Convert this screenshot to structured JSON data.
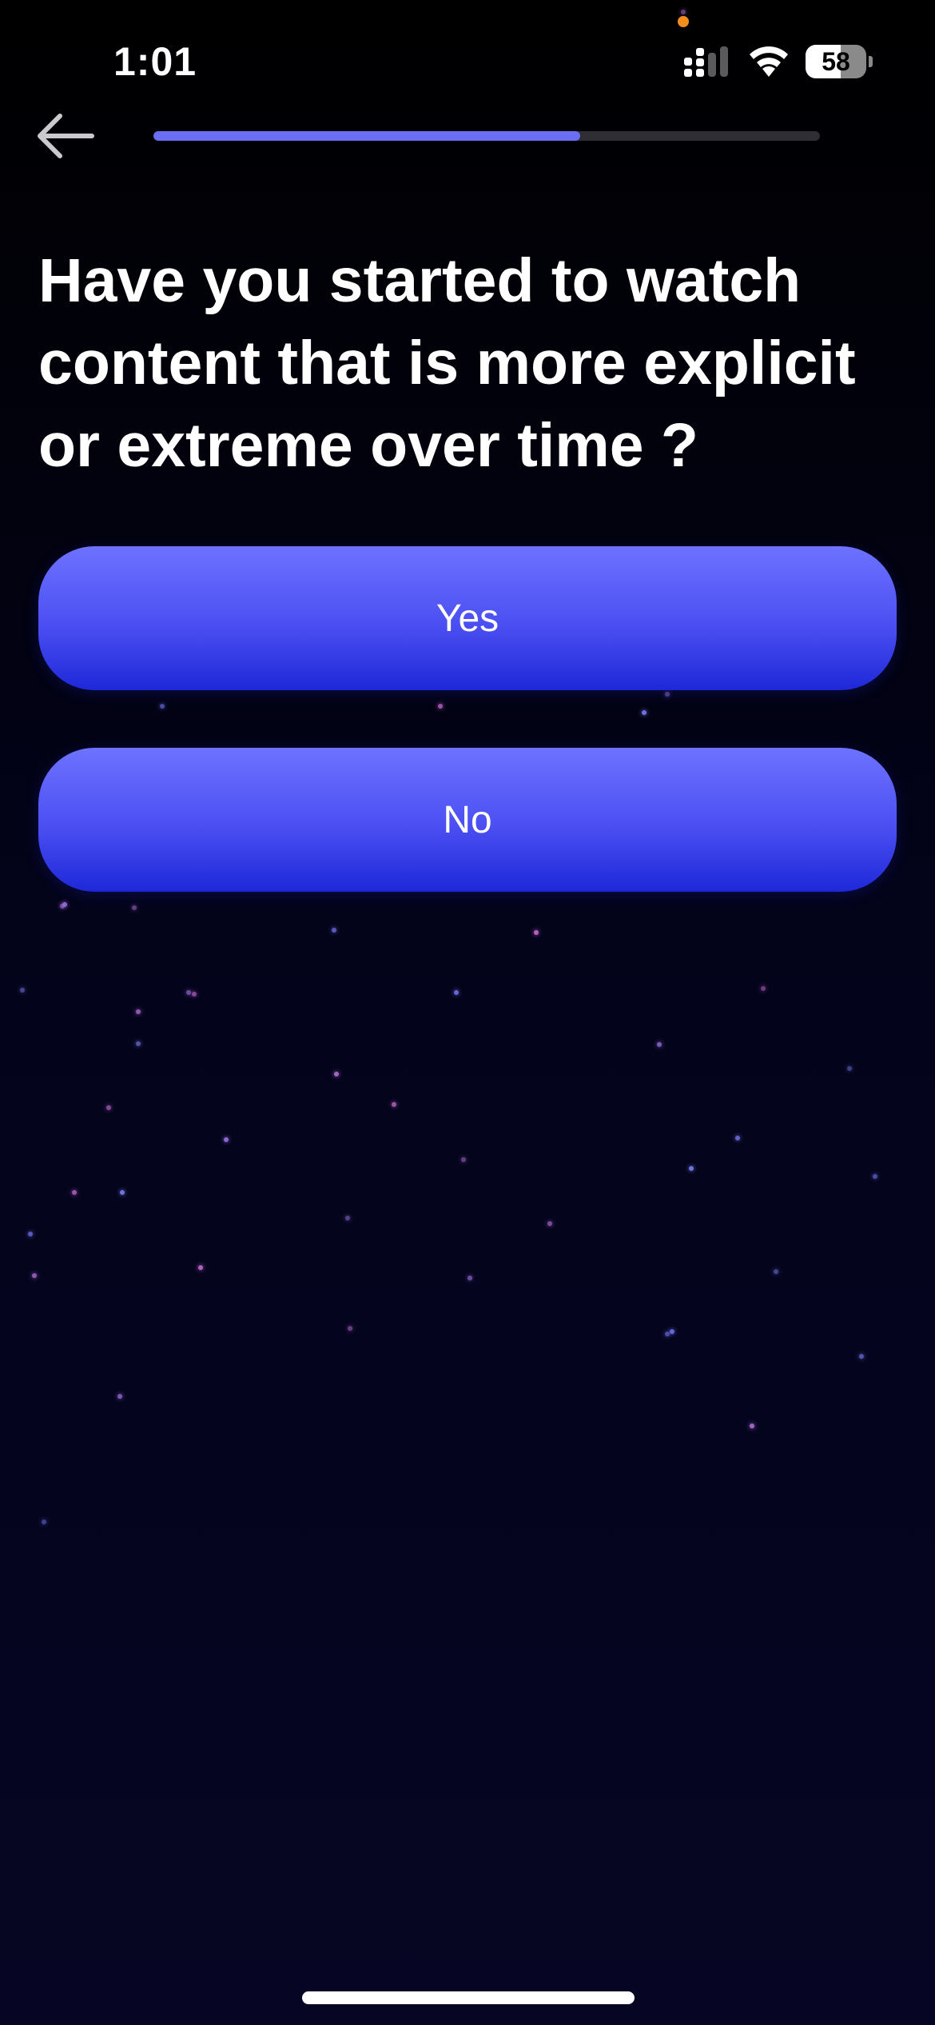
{
  "status_bar": {
    "time": "1:01",
    "battery_level": "58",
    "battery_fraction": 0.58,
    "privacy_dot_color": "#f28c1e"
  },
  "header": {
    "back_icon": "arrow-left-icon",
    "progress_fraction": 0.64,
    "progress_color": "#6b6ef2"
  },
  "question": {
    "text": "Have you started to watch content that is more explicit or extreme over time ?"
  },
  "answers": [
    {
      "label": "Yes"
    },
    {
      "label": "No"
    }
  ],
  "colors": {
    "button_top": "#6e72ff",
    "button_bottom": "#1e28d8",
    "background": "#03031a"
  }
}
